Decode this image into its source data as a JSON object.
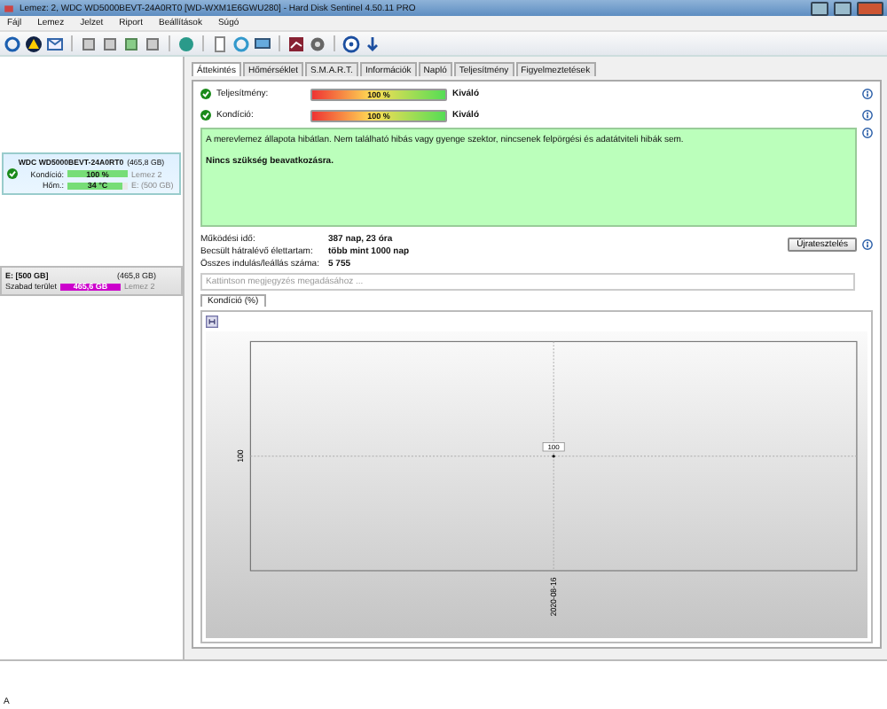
{
  "window": {
    "title": "Lemez: 2, WDC WD5000BEVT-24A0RT0 [WD-WXM1E6GWU280]  -  Hard Disk Sentinel 4.50.11 PRO"
  },
  "menu": [
    "Fájl",
    "Lemez",
    "Jelzet",
    "Riport",
    "Beállítások",
    "Súgó"
  ],
  "disk": {
    "name": "WDC WD5000BEVT-24A0RT0",
    "size": "(465,8 GB)",
    "ok": true,
    "metrics": [
      {
        "label": "Kondíció:",
        "value": "100 %",
        "level": 1,
        "note": "Lemez 2"
      },
      {
        "label": "Hőm.:",
        "value": "34 °C",
        "level": 0.9,
        "note": "E: (500 GB)"
      }
    ]
  },
  "volume": {
    "name": "E: [500 GB]",
    "size": "(465,8 GB)",
    "label": "Szabad terület",
    "value": "465,6 GB",
    "level": 1,
    "note": "Lemez 2"
  },
  "tabs": [
    {
      "label": "Áttekintés",
      "selected": true
    },
    {
      "label": "Hőmérséklet",
      "selected": false
    },
    {
      "label": "S.M.A.R.T.",
      "selected": false
    },
    {
      "label": "Információk",
      "selected": false
    },
    {
      "label": "Napló",
      "selected": false
    },
    {
      "label": "Teljesítmény",
      "selected": false
    },
    {
      "label": "Figyelmeztetések",
      "selected": false
    }
  ],
  "status_rows": [
    {
      "label": "Teljesítmény:",
      "value": "100 %",
      "level": 1,
      "rating": "Kiváló"
    },
    {
      "label": "Kondíció:",
      "value": "100 %",
      "level": 1,
      "rating": "Kiváló"
    }
  ],
  "message": {
    "text": "A merevlemez állapota hibátlan. Nem található hibás vagy gyenge szektor, nincsenek felpörgési és adatátviteli hibák sem.",
    "advice": "Nincs szükség beavatkozásra."
  },
  "info": [
    {
      "label": "Működési idő:",
      "value": "387 nap, 23 óra"
    },
    {
      "label": "Becsült hátralévő élettartam:",
      "value": "több mint 1000 nap"
    },
    {
      "label": "Összes indulás/leállás száma:",
      "value": "5 755"
    }
  ],
  "retest_button": "Újratesztelés",
  "note_field": {
    "placeholder": "Kattintson megjegyzés megadásához ..."
  },
  "chart_tab": {
    "label": "Kondíció  (%)",
    "selected": true
  },
  "chart": {
    "y_label": "100",
    "x_label": "2020-08-16",
    "point_label": "100"
  },
  "bottom_text": "A"
}
